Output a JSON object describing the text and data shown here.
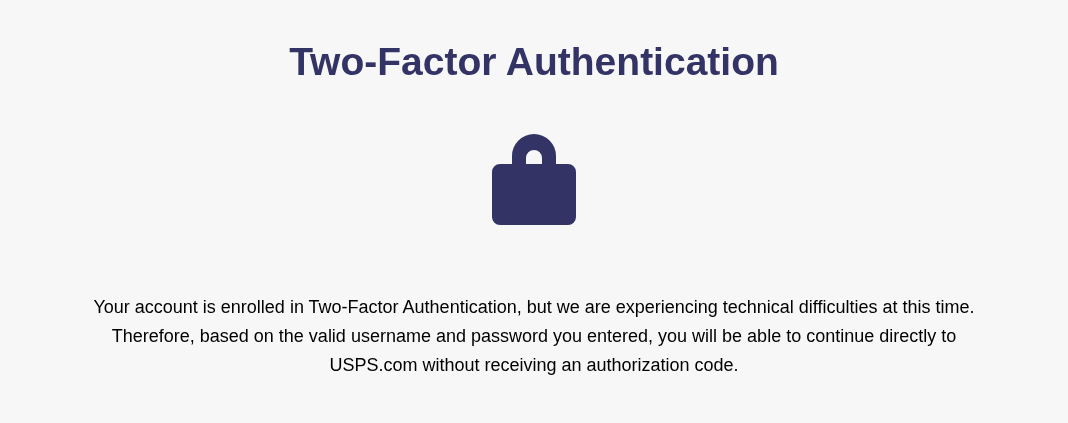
{
  "heading": "Two-Factor Authentication",
  "message": "Your account is enrolled in Two-Factor Authentication, but we are experiencing technical difficulties at this time. Therefore, based on the valid username and password you entered, you will be able to continue directly to USPS.com without receiving an authorization code."
}
